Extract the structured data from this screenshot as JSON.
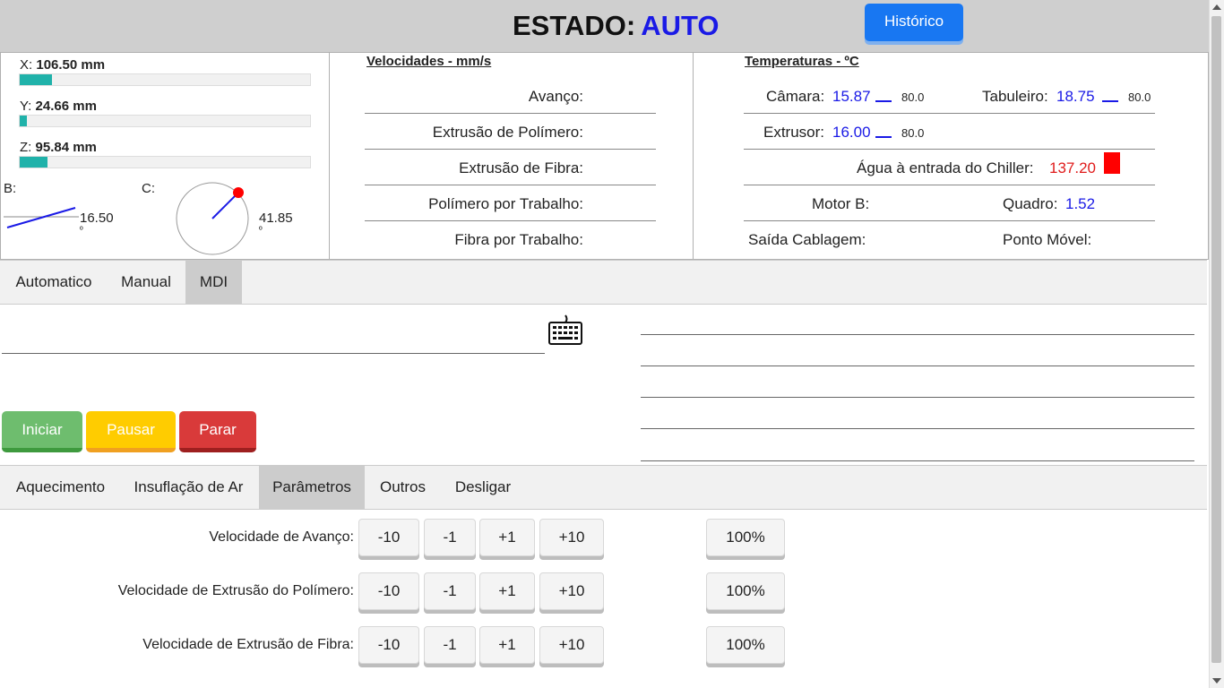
{
  "header": {
    "estado_label": "ESTADO:",
    "estado_value": "AUTO",
    "historico_label": "Histórico"
  },
  "position": {
    "x": {
      "label": "X:",
      "value": "106.50 mm",
      "fill_fraction": 0.11
    },
    "y": {
      "label": "Y:",
      "value": "24.66 mm",
      "fill_fraction": 0.025
    },
    "z": {
      "label": "Z:",
      "value": "95.84 mm",
      "fill_fraction": 0.095
    },
    "b": {
      "label": "B:",
      "value": "16.50",
      "unit": "º"
    },
    "c": {
      "label": "C:",
      "value": "41.85",
      "unit": "º"
    }
  },
  "velocidades": {
    "title": "Velocidades - mm/s",
    "rows": [
      "Avanço:",
      "Extrusão de Polímero:",
      "Extrusão de Fibra:",
      "Polímero por Trabalho:",
      "Fibra por Trabalho:"
    ]
  },
  "temperaturas": {
    "title": "Temperaturas - ºC",
    "camara": {
      "label": "Câmara:",
      "value": "15.87",
      "setpoint": "80.0"
    },
    "tabuleiro": {
      "label": "Tabuleiro:",
      "value": "18.75",
      "setpoint": "80.0"
    },
    "extrusor": {
      "label": "Extrusor:",
      "value": "16.00",
      "setpoint": "80.0"
    },
    "agua": {
      "label": "Água à entrada do Chiller:",
      "value": "137.20"
    },
    "motor_b": {
      "label": "Motor B:"
    },
    "quadro": {
      "label": "Quadro:",
      "value": "1.52"
    },
    "saida": {
      "label": "Saída Cablagem:"
    },
    "ponto": {
      "label": "Ponto Móvel:"
    },
    "colors": {
      "value": "#1a1ae6",
      "alarm": "#e01b1b"
    }
  },
  "mode_tabs": [
    "Automatico",
    "Manual",
    "MDI"
  ],
  "mode_active": "MDI",
  "controls": {
    "iniciar": "Iniciar",
    "pausar": "Pausar",
    "parar": "Parar"
  },
  "bottom_tabs": [
    "Aquecimento",
    "Insuflação de Ar",
    "Parâmetros",
    "Outros",
    "Desligar"
  ],
  "bottom_active": "Parâmetros",
  "parametros": {
    "rows": [
      {
        "label": "Velocidade de Avanço:",
        "buttons": [
          "-10",
          "-1",
          "+1",
          "+10"
        ],
        "reset": "100%"
      },
      {
        "label": "Velocidade de Extrusão do Polímero:",
        "buttons": [
          "-10",
          "-1",
          "+1",
          "+10"
        ],
        "reset": "100%"
      },
      {
        "label": "Velocidade de Extrusão de Fibra:",
        "buttons": [
          "-10",
          "-1",
          "+1",
          "+10"
        ],
        "reset": "100%"
      }
    ]
  }
}
